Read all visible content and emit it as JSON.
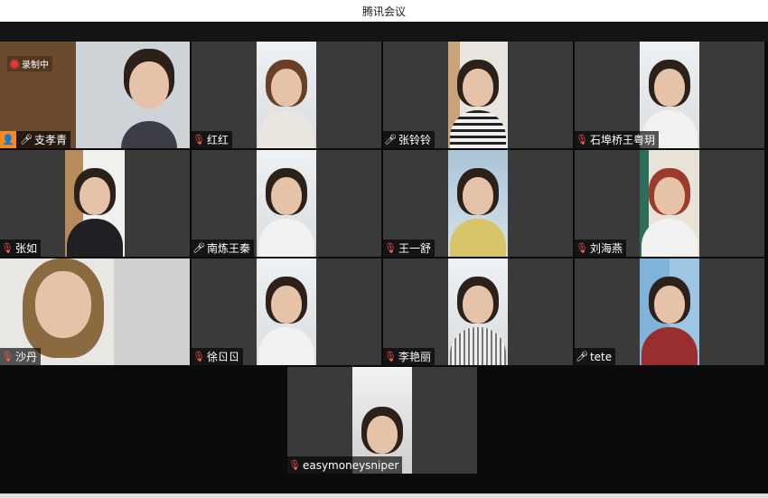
{
  "window": {
    "title": "腾讯会议"
  },
  "recording": {
    "label": "录制中"
  },
  "colors": {
    "active_speaker": "#2bb673",
    "muted_mic": "#ff5a4e",
    "host_badge": "#f58a1f"
  },
  "participants": [
    {
      "name": "支孝青",
      "mic": "on",
      "host": true,
      "active": true
    },
    {
      "name": "红红",
      "mic": "muted"
    },
    {
      "name": "张铃铃",
      "mic": "on"
    },
    {
      "name": "石埠桥王粤玥",
      "mic": "muted"
    },
    {
      "name": "张如",
      "mic": "muted"
    },
    {
      "name": "南炼王秦",
      "mic": "on"
    },
    {
      "name": "王一舒",
      "mic": "muted"
    },
    {
      "name": "刘海燕",
      "mic": "muted"
    },
    {
      "name": "沙丹",
      "mic": "muted"
    },
    {
      "name": "徐ㄖㄖ",
      "mic": "muted"
    },
    {
      "name": "李艳丽",
      "mic": "muted"
    },
    {
      "name": "tete",
      "mic": "on"
    },
    {
      "name": "easymoneysniper",
      "mic": "muted"
    }
  ]
}
